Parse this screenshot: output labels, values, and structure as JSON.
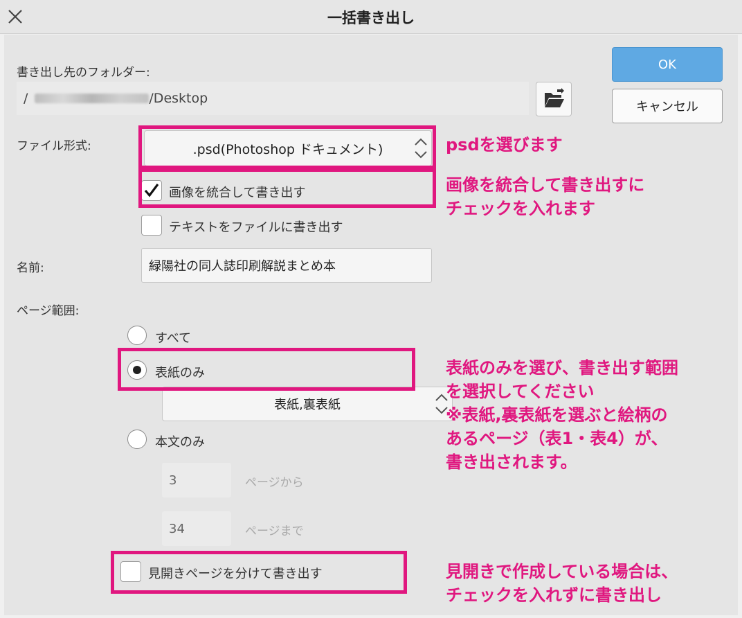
{
  "window": {
    "title": "一括書き出し"
  },
  "buttons": {
    "ok": "OK",
    "cancel": "キャンセル"
  },
  "export_folder": {
    "label": "書き出し先のフォルダー:",
    "path_prefix": "/",
    "path_suffix": "/Desktop"
  },
  "file_format": {
    "label": "ファイル形式:",
    "selected": ".psd(Photoshop ドキュメント)"
  },
  "options": {
    "merge_images": {
      "label": "画像を統合して書き出す",
      "checked": true
    },
    "export_text": {
      "label": "テキストをファイルに書き出す",
      "checked": false
    }
  },
  "name": {
    "label": "名前:",
    "value": "緑陽社の同人誌印刷解説まとめ本"
  },
  "page_range": {
    "label": "ページ範囲:",
    "all": "すべて",
    "cover_only": "表紙のみ",
    "cover_select": "表紙,裏表紙",
    "body_only": "本文のみ",
    "from_value": "3",
    "from_label": "ページから",
    "to_value": "34",
    "to_label": "ページまで",
    "selected": "cover_only"
  },
  "spread": {
    "label": "見開きページを分けて書き出す",
    "checked": false
  },
  "annotations": {
    "format": "psdを選びます",
    "merge": "画像を統合して書き出すに\nチェックを入れます",
    "cover": "表紙のみを選び、書き出す範囲\nを選択してください\n※表紙,裏表紙を選ぶと絵柄の\nあるページ（表1・表4）が、\n書き出されます。",
    "spread": "見開きで作成している場合は、\nチェックを入れずに書き出し"
  },
  "colors": {
    "accent": "#5fa9e3",
    "annotation": "#e0177f"
  }
}
